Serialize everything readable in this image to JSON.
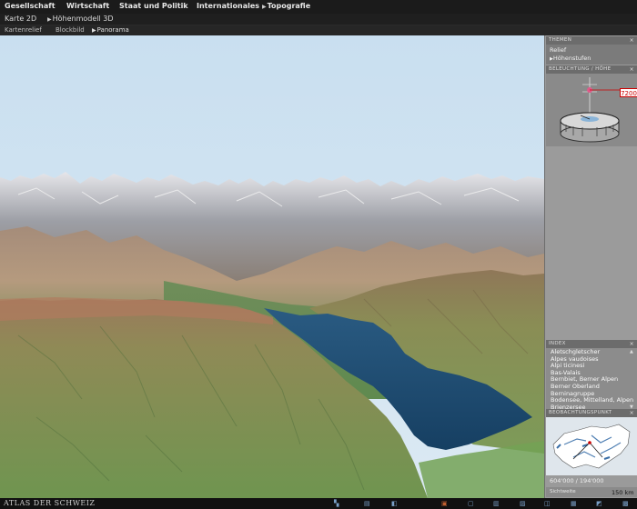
{
  "menu": {
    "items": [
      "Gesellschaft",
      "Wirtschaft",
      "Staat und Politik",
      "Internationales",
      "Topografie"
    ]
  },
  "modes": {
    "items": [
      "Karte 2D",
      "Höhenmodell 3D"
    ]
  },
  "views": {
    "items": [
      "Kartenrelief",
      "Blockbild",
      "Panorama"
    ]
  },
  "panel": {
    "themen_title": "THEMEN",
    "themen_items": [
      "Relief",
      "Höhenstufen"
    ],
    "light_title": "BELEUCHTUNG / HÖHE",
    "height_value": "7200",
    "index_title": "INDEX",
    "index_items": [
      "Aletschgletscher",
      "Alpes vaudoises",
      "Alpi ticinesi",
      "Bas-Valais",
      "Bernbiet, Berner Alpen",
      "Berner Oberland",
      "Berninagruppe",
      "Bodensee, Mittelland, Alpen",
      "Brienzersee"
    ],
    "beob_title": "BEOBACHTUNGSPUNKT",
    "coords": "604'000 / 194'000",
    "scale_label": "Sichtweite",
    "scale_value": "150 km",
    "close_symbol": "×"
  },
  "footer": {
    "brand": "ATLAS DER SCHWEIZ"
  },
  "colors": {
    "lake": "#1e4d73",
    "sky": "#cfe3f2",
    "accent_red": "#cc0000"
  }
}
